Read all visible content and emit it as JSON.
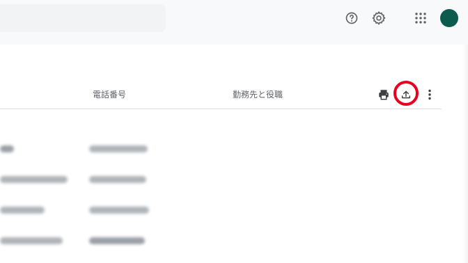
{
  "header": {
    "help_icon": "help-circle-icon",
    "settings_icon": "gear-icon",
    "apps_icon": "apps-grid-icon",
    "avatar_color": "#0b5b4f"
  },
  "table": {
    "columns": {
      "phone": "電話番号",
      "company_title": "勤務先と役職"
    },
    "toolbar": {
      "print_icon": "print-icon",
      "export_icon": "export-upload-icon",
      "more_icon": "more-vert-icon",
      "highlight_color": "#e8001c"
    },
    "rows": [
      {
        "name_redacted": true,
        "phone_redacted": true
      },
      {
        "name_redacted": true,
        "phone_redacted": true
      },
      {
        "name_redacted": true,
        "phone_redacted": true
      },
      {
        "name_redacted": true,
        "phone_redacted": true
      }
    ]
  }
}
